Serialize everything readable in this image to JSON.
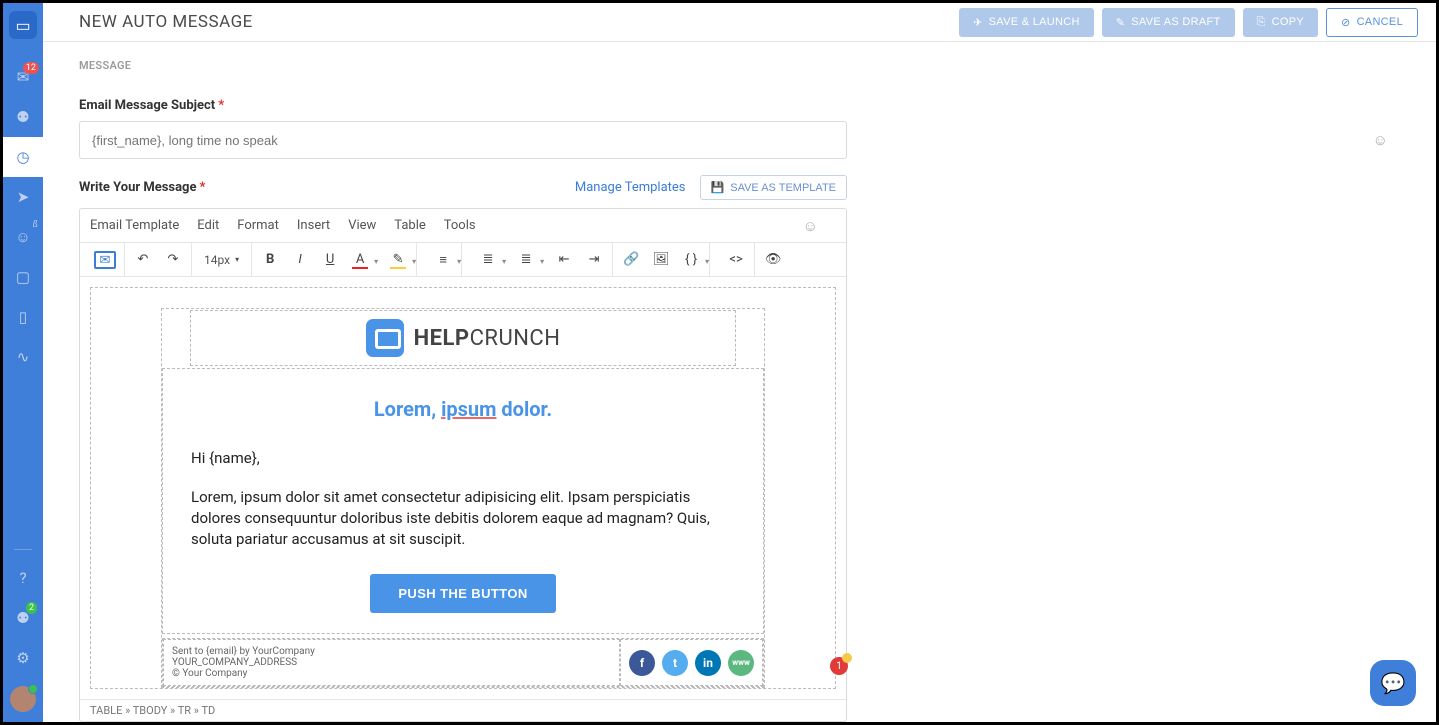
{
  "header": {
    "title": "NEW AUTO MESSAGE",
    "save_launch": "SAVE & LAUNCH",
    "save_draft": "SAVE AS DRAFT",
    "copy": "COPY",
    "cancel": "CANCEL"
  },
  "sidebar": {
    "inbox_badge": "12",
    "invite_badge": "2"
  },
  "section": {
    "message": "MESSAGE"
  },
  "subject": {
    "label": "Email Message Subject",
    "placeholder": "{first_name}, long time no speak"
  },
  "message": {
    "label": "Write Your Message",
    "manage_templates": "Manage Templates",
    "save_as_template": "SAVE AS TEMPLATE"
  },
  "menu": {
    "email_template": "Email Template",
    "edit": "Edit",
    "format": "Format",
    "insert": "Insert",
    "view": "View",
    "table": "Table",
    "tools": "Tools"
  },
  "toolbar": {
    "font_size": "14px"
  },
  "email": {
    "logo_text_bold": "HELP",
    "logo_text_light": "CRUNCH",
    "headline_pre": "Lorem, ",
    "headline_u": "ipsum",
    "headline_post": " dolor.",
    "greet": "Hi {name},",
    "body": "Lorem, ipsum dolor sit amet consectetur adipisicing elit. Ipsam perspiciatis dolores consequuntur doloribus iste debitis dolorem eaque ad magnam? Quis, soluta pariatur accusamus at sit suscipit.",
    "cta": "PUSH THE BUTTON",
    "sent_to": "Sent to {email} by YourCompany",
    "address": "YOUR_COMPANY_ADDRESS",
    "copyright": "© Your Company",
    "www": "www"
  },
  "notif": "1",
  "breadcrumb": "TABLE » TBODY » TR » TD"
}
